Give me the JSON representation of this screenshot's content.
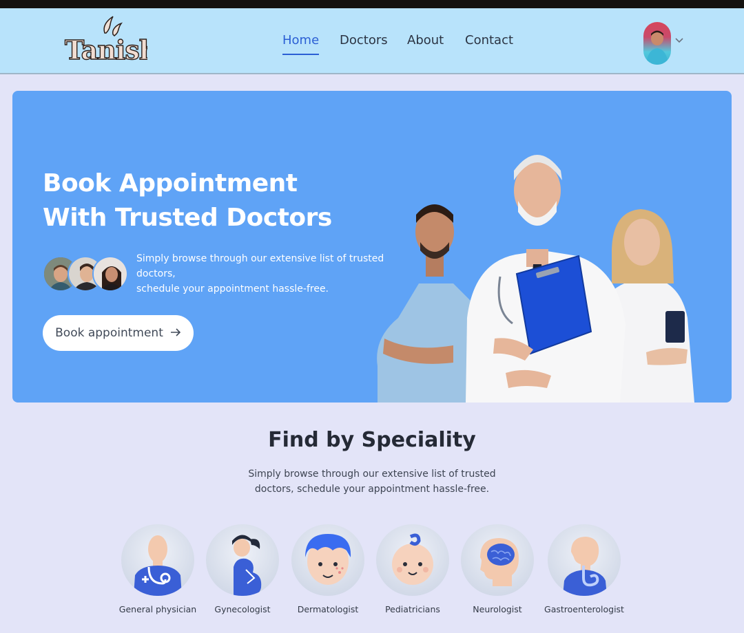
{
  "brand": {
    "logo_text": "Tanish"
  },
  "nav": {
    "links": [
      {
        "label": "Home",
        "active": true
      },
      {
        "label": "Doctors",
        "active": false
      },
      {
        "label": "About",
        "active": false
      },
      {
        "label": "Contact",
        "active": false
      }
    ]
  },
  "user": {
    "avatar_icon": "user-avatar",
    "menu_icon": "chevron-down-icon"
  },
  "hero": {
    "title_line1": "Book Appointment",
    "title_line2": "With Trusted Doctors",
    "desc_line1": "Simply browse through our extensive list of trusted",
    "desc_line2": "doctors,",
    "desc_line3": "schedule your appointment hassle-free.",
    "button_label": "Book appointment",
    "button_icon": "arrow-right-icon"
  },
  "speciality": {
    "title": "Find by Speciality",
    "desc_line1": "Simply browse through our extensive list of trusted",
    "desc_line2": "doctors, schedule your appointment hassle-free.",
    "items": [
      {
        "label": "General physician",
        "icon": "general-physician-icon"
      },
      {
        "label": "Gynecologist",
        "icon": "gynecologist-icon"
      },
      {
        "label": "Dermatologist",
        "icon": "dermatologist-icon"
      },
      {
        "label": "Pediatricians",
        "icon": "pediatrician-icon"
      },
      {
        "label": "Neurologist",
        "icon": "neurologist-icon"
      },
      {
        "label": "Gastroenterologist",
        "icon": "gastroenterologist-icon"
      }
    ]
  },
  "colors": {
    "navbar_bg": "#b8e3fb",
    "hero_bg": "#5fa3f6",
    "page_bg": "#e3e4f8",
    "accent": "#2b5fd4",
    "icon_blue": "#3a5fd6"
  }
}
